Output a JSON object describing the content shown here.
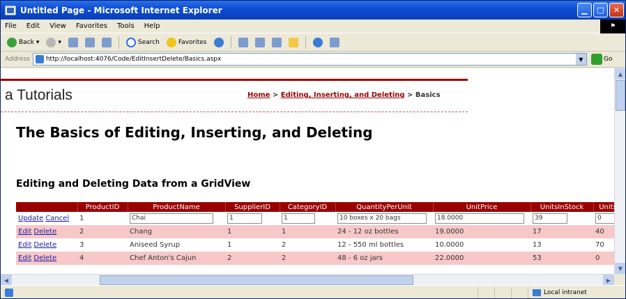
{
  "window": {
    "title": "Untitled Page - Microsoft Internet Explorer"
  },
  "menu": {
    "items": [
      "File",
      "Edit",
      "View",
      "Favorites",
      "Tools",
      "Help"
    ]
  },
  "toolbar": {
    "back": "Back",
    "search": "Search",
    "favorites": "Favorites"
  },
  "address": {
    "label": "Address",
    "url": "http://localhost:4076/Code/EditInsertDelete/Basics.aspx",
    "go": "Go"
  },
  "site": {
    "title": "a Tutorials"
  },
  "breadcrumb": {
    "home": "Home",
    "sep1": " > ",
    "section": "Editing, Inserting, and Deleting",
    "sep2": " > ",
    "current": "Basics"
  },
  "page": {
    "heading": "The Basics of Editing, Inserting, and Deleting",
    "subheading": "Editing and Deleting Data from a GridView"
  },
  "grid": {
    "columns": [
      "",
      "ProductID",
      "ProductName",
      "SupplierID",
      "CategoryID",
      "QuantityPerUnit",
      "UnitPrice",
      "UnitsInStock",
      "Units"
    ],
    "edit_row": {
      "update": "Update",
      "cancel": "Cancel",
      "cells": [
        "1",
        "Chai",
        "1",
        "1",
        "10 boxes x 20 bags",
        "18.0000",
        "39",
        "0"
      ]
    },
    "rows": [
      {
        "edit": "Edit",
        "delete": "Delete",
        "cells": [
          "2",
          "Chang",
          "1",
          "1",
          "24 - 12 oz bottles",
          "19.0000",
          "17",
          "40"
        ]
      },
      {
        "edit": "Edit",
        "delete": "Delete",
        "cells": [
          "3",
          "Aniseed Syrup",
          "1",
          "2",
          "12 - 550 ml bottles",
          "10.0000",
          "13",
          "70"
        ]
      },
      {
        "edit": "Edit",
        "delete": "Delete",
        "cells": [
          "4",
          "Chef Anton's Cajun",
          "2",
          "2",
          "48 - 6 oz jars",
          "22.0000",
          "53",
          "0"
        ]
      }
    ]
  },
  "status": {
    "zone": "Local intranet"
  },
  "colors": {
    "header": "#990000",
    "alt_row": "#f7c8c8",
    "titlebar": "#0b4bd2"
  }
}
